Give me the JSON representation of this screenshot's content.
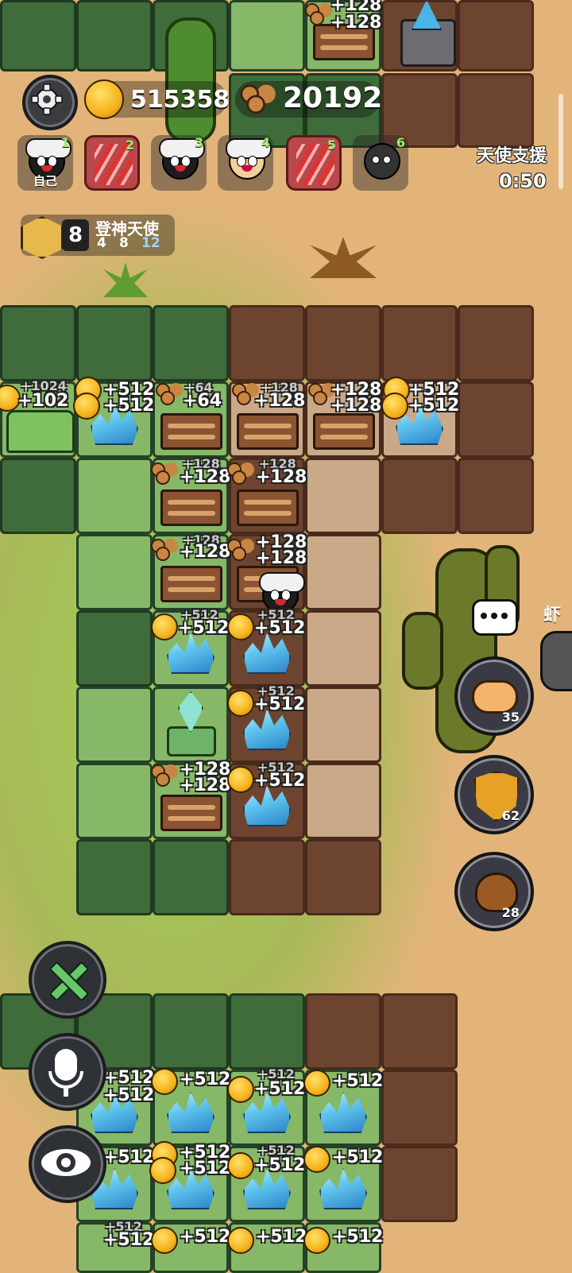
{
  "resources": {
    "gold": "515358",
    "wood": "20192"
  },
  "players": [
    {
      "slot": "1",
      "label": "自己"
    },
    {
      "slot": "2",
      "label": ""
    },
    {
      "slot": "3",
      "label": ""
    },
    {
      "slot": "4",
      "label": ""
    },
    {
      "slot": "5",
      "label": ""
    },
    {
      "slot": "6",
      "label": ""
    }
  ],
  "angel": {
    "title": "天使支援",
    "timer": "0:50"
  },
  "rank": {
    "level": "8",
    "title": "登神天使",
    "thresholds": [
      "4",
      "8",
      "12"
    ]
  },
  "side_buttons": {
    "piggy_count": "35",
    "shield_count": "62",
    "poop_count": "28"
  },
  "offscreen_name": "虾",
  "yields": {
    "top_wood_1": "+128",
    "top_wood_2": "+128",
    "r1_home_faint": "+1024",
    "r1_home": "+102",
    "r1_c1a": "+512",
    "r1_c1b": "+512",
    "r1_w1_faint": "+64",
    "r1_w1": "+64",
    "r1_w2_faint": "+128",
    "r1_w2": "+128",
    "r1_w3a": "+128",
    "r1_w3b": "+128",
    "r1_c2a": "+512",
    "r1_c2b": "+512",
    "r2_w1_faint": "+128",
    "r2_w1": "+128",
    "r2_w2_faint": "+128",
    "r2_w2": "+128",
    "r3_w1_faint": "+128",
    "r3_w1": "+128",
    "r3_w2a": "+128",
    "r3_w2b": "+128",
    "r4_c1_faint": "+512",
    "r4_c1": "+512",
    "r4_c2_faint": "+512",
    "r4_c2": "+512",
    "r5_c1_faint": "+512",
    "r5_c1": "+512",
    "r6_w1a": "+128",
    "r6_w1b": "+128",
    "r6_c1_faint": "+512",
    "r6_c1": "+512",
    "b1_a": "+512",
    "b1_b": "+512",
    "b1_c": "+512",
    "b1_d_faint": "+512",
    "b1_d": "+512",
    "b1_e": "+512",
    "b2_a": "+512",
    "b2_b": "+512",
    "b2_b2": "+512",
    "b2_c_faint": "+512",
    "b2_c": "+512",
    "b2_d": "+512",
    "b3_a_faint": "+512",
    "b3_a": "+512",
    "b3_b": "+512",
    "b3_c": "+512",
    "b3_d": "+512"
  }
}
